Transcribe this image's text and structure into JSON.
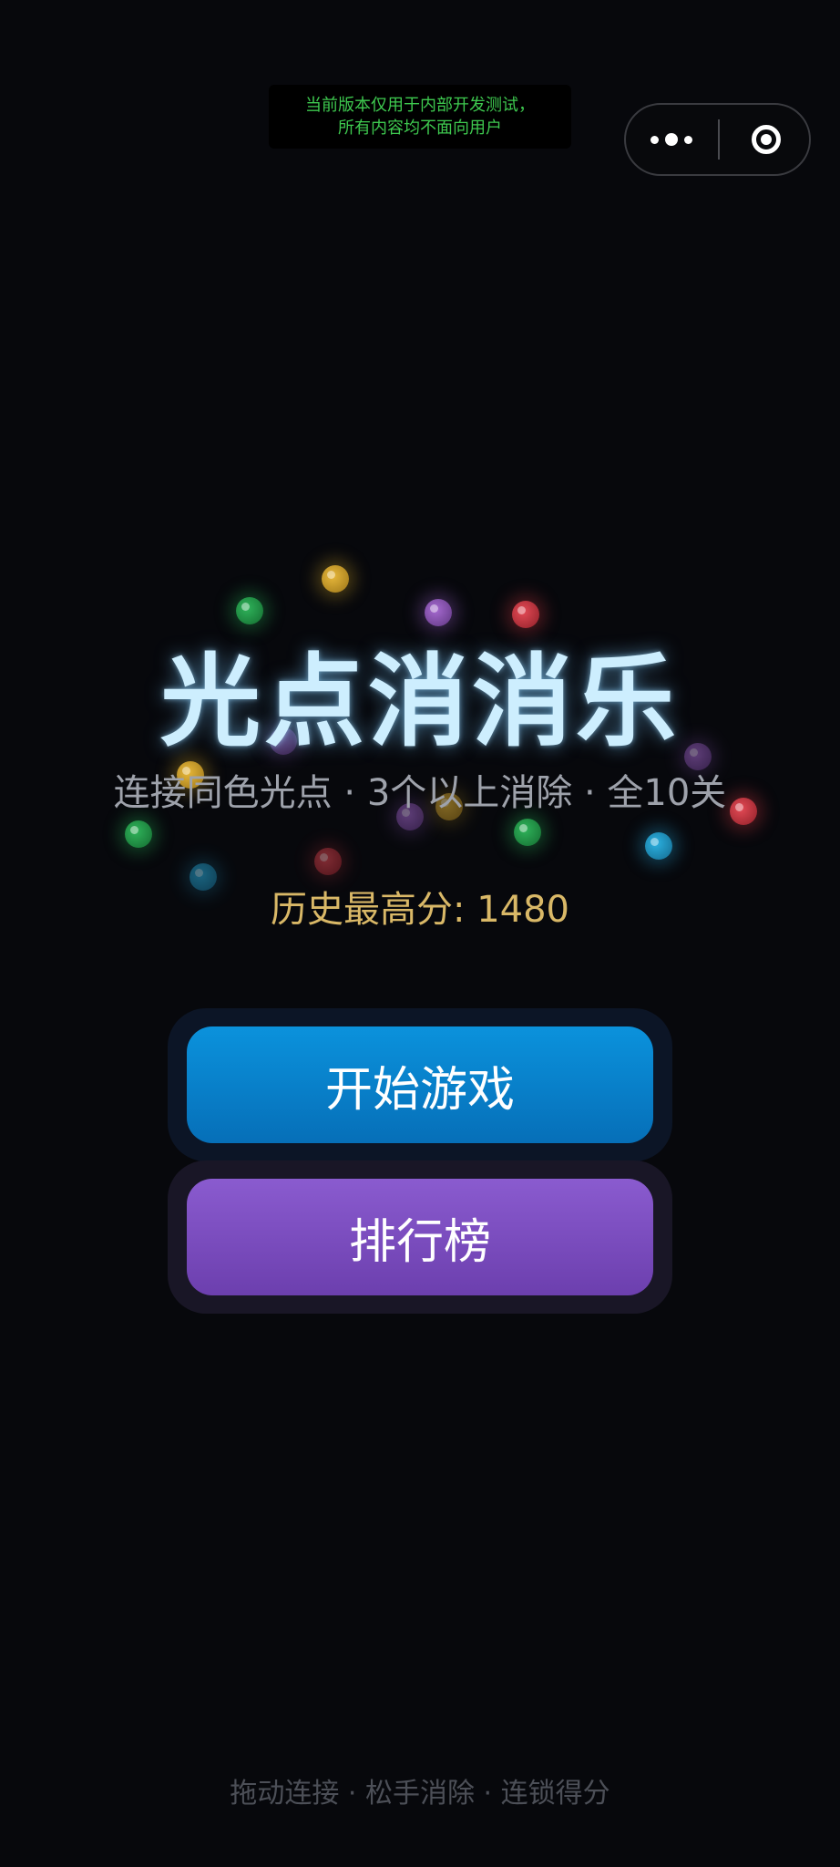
{
  "dev_notice": {
    "line1": "当前版本仅用于内部开发测试，",
    "line2": "所有内容均不面向用户"
  },
  "capsule": {
    "more_icon": "more-dots-icon",
    "close_icon": "target-circle-icon"
  },
  "title": "光点消消乐",
  "subtitle": "连接同色光点 · 3个以上消除 · 全10关",
  "highscore": "历史最高分: 1480",
  "buttons": {
    "start_label": "开始游戏",
    "rank_label": "排行榜"
  },
  "footer": "拖动连接 · 松手消除 · 连锁得分",
  "colors": {
    "background": "#07080c",
    "title": "#cdeefe",
    "highscore": "#d9b867",
    "start_button": "#0b92dc",
    "rank_button": "#8a5bcf",
    "dev_notice_text": "#3ec94f"
  },
  "orb_colors": [
    "yellow",
    "green",
    "purple",
    "red",
    "cyan"
  ]
}
